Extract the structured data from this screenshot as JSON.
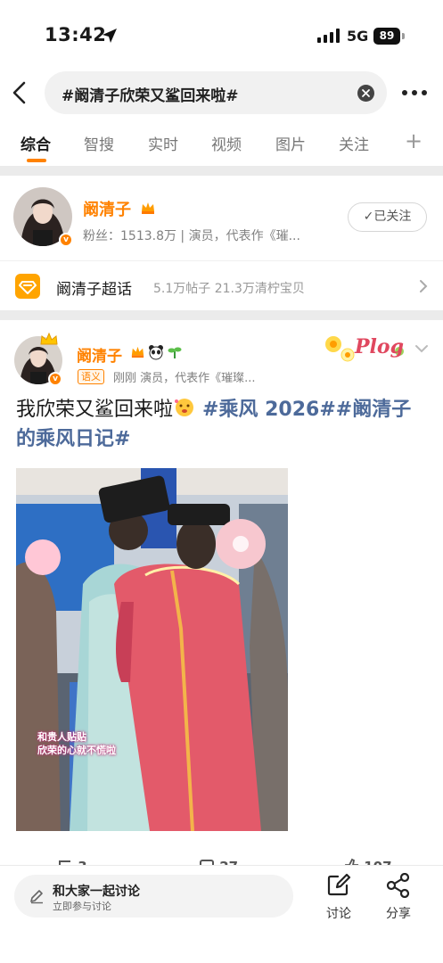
{
  "status_bar": {
    "time": "13:42",
    "network": "5G",
    "battery": "89"
  },
  "search": {
    "query": "#阚清子欣荣又鲨回来啦#"
  },
  "tabs": {
    "items": [
      "综合",
      "智搜",
      "实时",
      "视频",
      "图片",
      "关注"
    ],
    "active": "综合",
    "add": "+"
  },
  "profile": {
    "name": "阚清子",
    "description": "粉丝：1513.8万 | 演员，代表作《璀...",
    "follow_label": "已关注"
  },
  "supertopic": {
    "name": "阚清子超话",
    "stats": "5.1万帖子  21.3万清柠宝贝"
  },
  "post": {
    "author": "阚清子",
    "tag": "语义",
    "meta": "刚刚  演员，代表作《璀璨...",
    "sticker_text": "Plog",
    "text_plain": "我欣荣又鲨回来啦",
    "hashtags": "#乘风 2026##阚清子的乘风日记#",
    "image_caption_line1": "和贵人贴贴",
    "image_caption_line2": "欣荣的心就不慌啦",
    "actions": {
      "reposts": "3",
      "comments": "27",
      "likes": "107"
    }
  },
  "bottom_bar": {
    "discuss_title": "和大家一起讨论",
    "discuss_sub": "立即参与讨论",
    "comment_label": "讨论",
    "share_label": "分享"
  },
  "colors": {
    "accent": "#ff8200",
    "hashtag": "#4d6a9a"
  }
}
